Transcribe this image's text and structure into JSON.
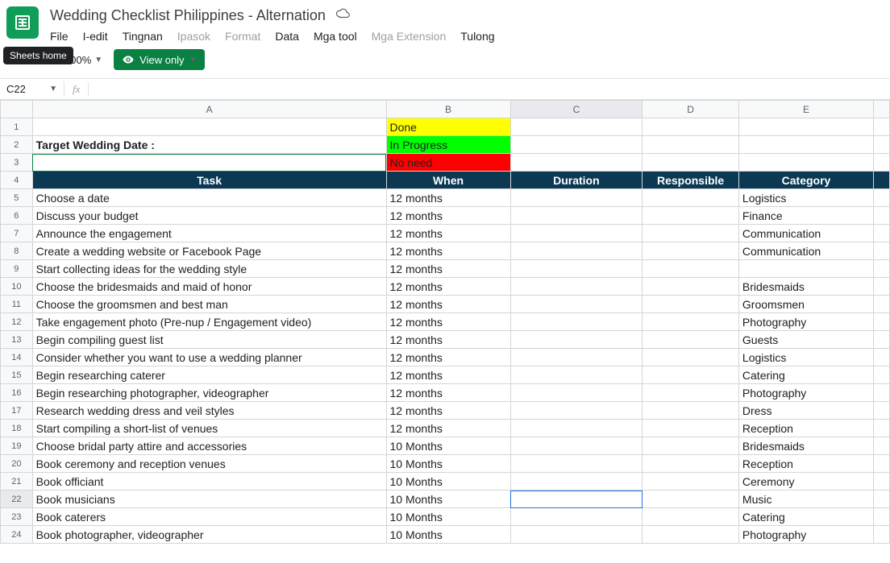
{
  "tooltip": "Sheets home",
  "title": "Wedding Checklist Philippines - Alternation",
  "menus": [
    {
      "label": "File",
      "disabled": false
    },
    {
      "label": "I-edit",
      "disabled": false
    },
    {
      "label": "Tingnan",
      "disabled": false
    },
    {
      "label": "Ipasok",
      "disabled": true
    },
    {
      "label": "Format",
      "disabled": true
    },
    {
      "label": "Data",
      "disabled": false
    },
    {
      "label": "Mga tool",
      "disabled": false
    },
    {
      "label": "Mga Extension",
      "disabled": true
    },
    {
      "label": "Tulong",
      "disabled": false
    }
  ],
  "zoom": "100%",
  "view_only": "View only",
  "name_box": "C22",
  "columns": [
    "A",
    "B",
    "C",
    "D",
    "E"
  ],
  "status": {
    "done": "Done",
    "progress": "In Progress",
    "noneed": "No need"
  },
  "header_row": {
    "task": "Task",
    "when": "When",
    "duration": "Duration",
    "responsible": "Responsible",
    "category": "Category"
  },
  "target_label": "Target Wedding Date :",
  "rows": [
    {
      "n": 5,
      "task": "Choose a date",
      "when": "12 months",
      "cat": "Logistics"
    },
    {
      "n": 6,
      "task": "Discuss your budget",
      "when": "12 months",
      "cat": "Finance"
    },
    {
      "n": 7,
      "task": "Announce the engagement",
      "when": "12 months",
      "cat": "Communication"
    },
    {
      "n": 8,
      "task": "Create a wedding website or Facebook Page",
      "when": "12 months",
      "cat": "Communication"
    },
    {
      "n": 9,
      "task": "Start collecting ideas for the wedding style",
      "when": "12 months",
      "cat": ""
    },
    {
      "n": 10,
      "task": "Choose the bridesmaids and maid of honor",
      "when": "12 months",
      "cat": "Bridesmaids"
    },
    {
      "n": 11,
      "task": "Choose the groomsmen and best man",
      "when": "12 months",
      "cat": "Groomsmen"
    },
    {
      "n": 12,
      "task": "Take engagement photo (Pre-nup / Engagement video)",
      "when": "12 months",
      "cat": "Photography"
    },
    {
      "n": 13,
      "task": "Begin compiling guest list",
      "when": "12 months",
      "cat": "Guests"
    },
    {
      "n": 14,
      "task": "Consider whether you want to use a wedding planner",
      "when": "12 months",
      "cat": "Logistics"
    },
    {
      "n": 15,
      "task": "Begin researching caterer",
      "when": "12 months",
      "cat": "Catering"
    },
    {
      "n": 16,
      "task": "Begin researching photographer, videographer",
      "when": "12 months",
      "cat": "Photography"
    },
    {
      "n": 17,
      "task": "Research wedding dress and veil styles",
      "when": "12 months",
      "cat": "Dress"
    },
    {
      "n": 18,
      "task": "Start compiling a short-list of venues",
      "when": "12 months",
      "cat": "Reception"
    },
    {
      "n": 19,
      "task": "Choose bridal party attire and accessories",
      "when": "10 Months",
      "cat": "Bridesmaids"
    },
    {
      "n": 20,
      "task": "Book ceremony and reception venues",
      "when": "10 Months",
      "cat": "Reception"
    },
    {
      "n": 21,
      "task": "Book officiant",
      "when": "10 Months",
      "cat": "Ceremony"
    },
    {
      "n": 22,
      "task": "Book musicians",
      "when": "10 Months",
      "cat": "Music"
    },
    {
      "n": 23,
      "task": "Book caterers",
      "when": "10 Months",
      "cat": "Catering"
    },
    {
      "n": 24,
      "task": "Book photographer, videographer",
      "when": "10 Months",
      "cat": "Photography"
    }
  ],
  "selected": {
    "row": 22,
    "col": "C"
  }
}
